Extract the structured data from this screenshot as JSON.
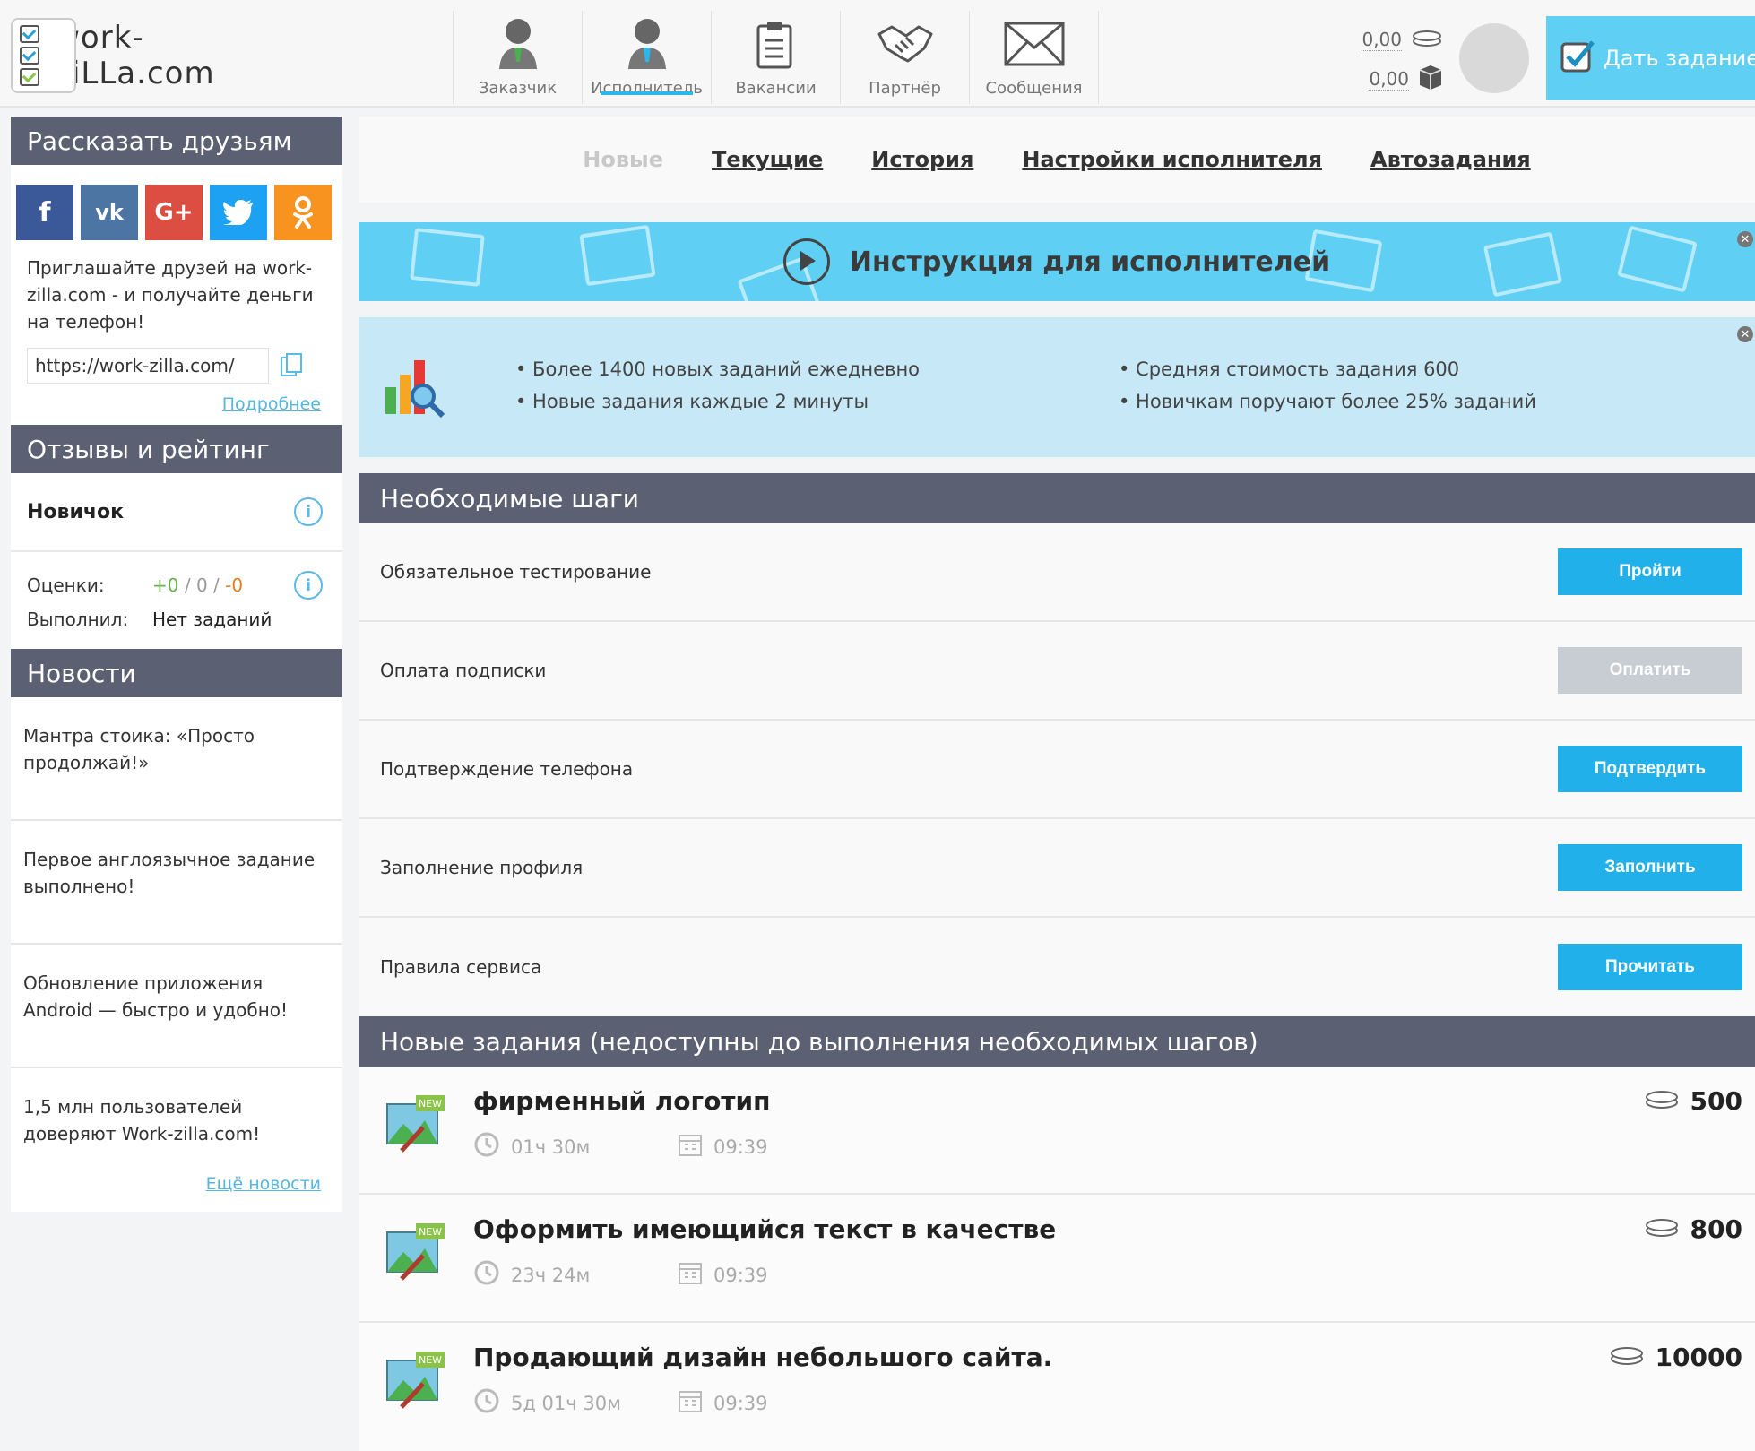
{
  "header": {
    "logo_text": "work-ziLLa.com",
    "nav": [
      {
        "label": "Заказчик",
        "icon": "customer-icon"
      },
      {
        "label": "Исполнитель",
        "icon": "performer-icon",
        "active": true
      },
      {
        "label": "Вакансии",
        "icon": "vacancies-icon"
      },
      {
        "label": "Партнёр",
        "icon": "handshake-icon"
      },
      {
        "label": "Сообщения",
        "icon": "envelope-icon"
      }
    ],
    "balance_coins": "0,00",
    "balance_box": "0,00",
    "give_task_label": "Дать задание"
  },
  "sidebar": {
    "share": {
      "title": "Рассказать друзьям",
      "networks": [
        "f",
        "vk",
        "G+",
        "twitter",
        "ok"
      ],
      "invite_text": "Приглашайте друзей на work-zilla.com - и получайте деньги на телефон!",
      "ref_link": "https://work-zilla.com/",
      "more_label": "Подробнее"
    },
    "rating": {
      "title": "Отзывы и рейтинг",
      "rank": "Новичок",
      "grades_label": "Оценки:",
      "grade_pos": "+0",
      "grade_sep1": " / ",
      "grade_neu": "0",
      "grade_sep2": " / ",
      "grade_neg": "-0",
      "done_label": "Выполнил:",
      "done_value": "Нет заданий"
    },
    "news": {
      "title": "Новости",
      "items": [
        "Мантра стоика: «Просто продолжай!»",
        "Первое англоязычное задание выполнено!",
        "Обновление приложения Android — быстро и удобно!",
        "1,5 млн пользователей доверяют Work-zilla.com!"
      ],
      "more_label": "Ещё новости"
    }
  },
  "main": {
    "tabs": [
      {
        "label": "Новые",
        "disabled": true
      },
      {
        "label": "Текущие"
      },
      {
        "label": "История"
      },
      {
        "label": "Настройки исполнителя"
      },
      {
        "label": "Автозадания"
      }
    ],
    "instruction_banner": "Инструкция для исполнителей",
    "facts": {
      "left": [
        "• Более 1400 новых заданий ежедневно",
        "• Новые задания каждые 2 минуты"
      ],
      "right": [
        "• Средняя стоимость задания 600",
        "• Новичкам поручают более 25% заданий"
      ]
    },
    "steps_title": "Необходимые шаги",
    "steps": [
      {
        "label": "Обязательное тестирование",
        "button": "Пройти"
      },
      {
        "label": "Оплата подписки",
        "button": "Оплатить",
        "disabled": true
      },
      {
        "label": "Подтверждение телефона",
        "button": "Подтвердить"
      },
      {
        "label": "Заполнение профиля",
        "button": "Заполнить"
      },
      {
        "label": "Правила сервиса",
        "button": "Прочитать"
      }
    ],
    "tasks_title": "Новые задания (недоступны до выполнения необходимых шагов)",
    "tasks": [
      {
        "title": "фирменный логотип",
        "duration": "01ч 30м",
        "time": "09:39",
        "price": "500",
        "badge": "NEW"
      },
      {
        "title": "Оформить имеющийся текст в качестве",
        "duration": "23ч 24м",
        "time": "09:39",
        "price": "800",
        "badge": "NEW"
      },
      {
        "title": "Продающий дизайн небольшого сайта.",
        "duration": "5д 01ч 30м",
        "time": "09:39",
        "price": "10000",
        "badge": "NEW"
      }
    ]
  },
  "colors": {
    "accent": "#21b0ea",
    "header_dark": "#5c6073",
    "banner": "#5fd0f3",
    "facts_bg": "#c7e9f7"
  }
}
